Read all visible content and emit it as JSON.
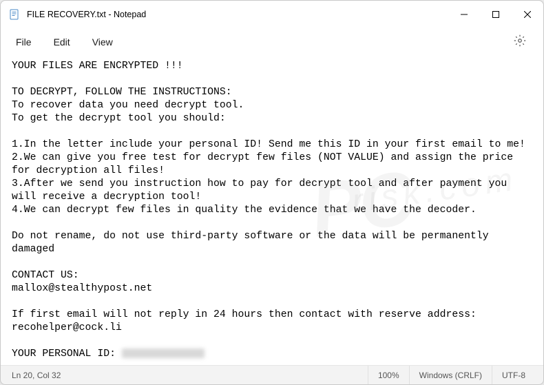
{
  "window": {
    "title": "FILE RECOVERY.txt - Notepad"
  },
  "menu": {
    "file": "File",
    "edit": "Edit",
    "view": "View"
  },
  "body": {
    "l1": "YOUR FILES ARE ENCRYPTED !!!",
    "l2": "",
    "l3": "TO DECRYPT, FOLLOW THE INSTRUCTIONS:",
    "l4": "To recover data you need decrypt tool.",
    "l5": "To get the decrypt tool you should:",
    "l6": "",
    "l7": "1.In the letter include your personal ID! Send me this ID in your first email to me!",
    "l8": "2.We can give you free test for decrypt few files (NOT VALUE) and assign the price for decryption all files!",
    "l9": "3.After we send you instruction how to pay for decrypt tool and after payment you will receive a decryption tool!",
    "l10": "4.We can decrypt few files in quality the evidence that we have the decoder.",
    "l11": "",
    "l12": "Do not rename, do not use third-party software or the data will be permanently damaged",
    "l13": "",
    "l14": "CONTACT US:",
    "l15": "mallox@stealthypost.net",
    "l16": "",
    "l17": "If first email will not reply in 24 hours then contact with reserve address:",
    "l18": "recohelper@cock.li",
    "l19": "",
    "l20": "YOUR PERSONAL ID: "
  },
  "status": {
    "cursor": "Ln 20, Col 32",
    "zoom": "100%",
    "line_ending": "Windows (CRLF)",
    "encoding": "UTF-8"
  },
  "watermark": {
    "brand": "PC",
    "sub": "risk.com"
  }
}
